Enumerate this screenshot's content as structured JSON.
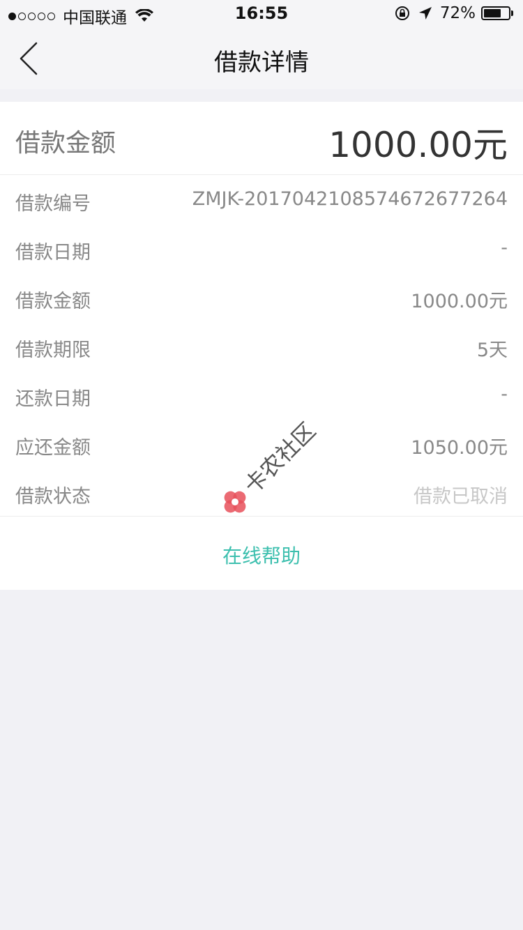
{
  "status_bar": {
    "carrier": "中国联通",
    "time": "16:55",
    "battery": "72%",
    "battery_level": 0.72
  },
  "nav": {
    "title": "借款详情",
    "back_icon": "chevron-left-icon"
  },
  "summary": {
    "label": "借款金额",
    "value": "1000.00元"
  },
  "details": [
    {
      "label": "借款编号",
      "value": "ZMJK-20170421085746726772­64"
    },
    {
      "label": "借款日期",
      "value": "-"
    },
    {
      "label": "借款金额",
      "value": "1000.00元"
    },
    {
      "label": "借款期限",
      "value": "5天"
    },
    {
      "label": "还款日期",
      "value": "-"
    },
    {
      "label": "应还金额",
      "value": "1050.00元"
    },
    {
      "label": "借款状态",
      "value": "借款已取消"
    }
  ],
  "help_link": "在线帮助",
  "watermark": "卡农社区",
  "colors": {
    "accent": "#3cbfae",
    "background": "#f1f1f5",
    "watermark_red": "#e8505b"
  }
}
